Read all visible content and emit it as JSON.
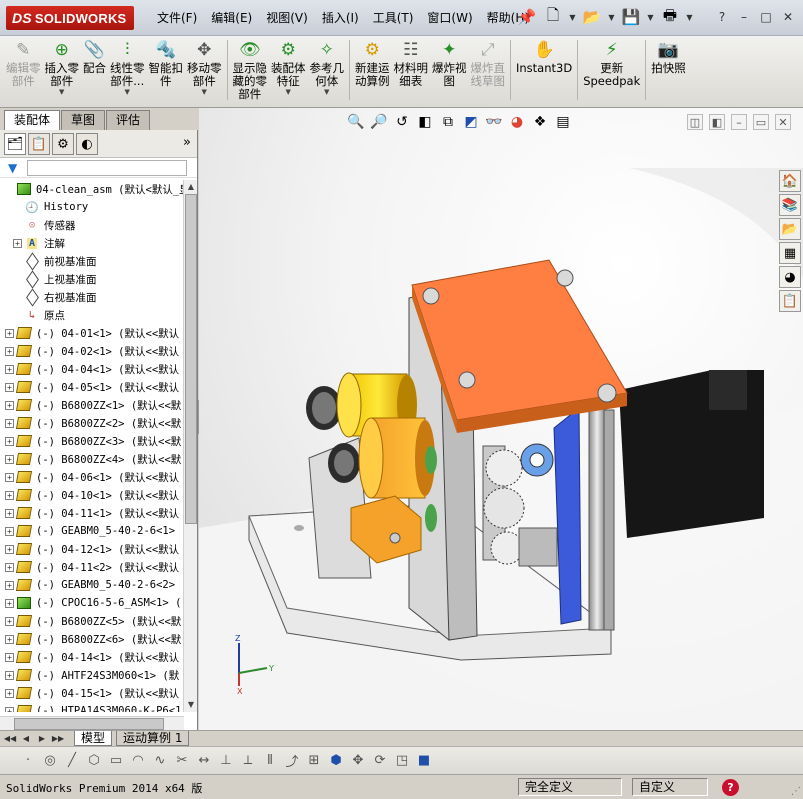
{
  "app": {
    "logo_ds": "DS",
    "logo_text": "SOLIDWORKS",
    "menus": [
      "文件(F)",
      "编辑(E)",
      "视图(V)",
      "插入(I)",
      "工具(T)",
      "窗口(W)",
      "帮助(H)"
    ],
    "topicons": [
      "pin-icon",
      "new-document-icon",
      "open-folder-icon",
      "save-icon",
      "print-icon",
      "help-icon"
    ],
    "window_controls": [
      "?",
      "–",
      "□",
      "✕"
    ]
  },
  "commands": [
    {
      "name": "edit-component",
      "label": "编辑零\n部件",
      "disabled": true,
      "dropdown": false
    },
    {
      "name": "insert-component",
      "label": "插入零\n部件",
      "disabled": false,
      "dropdown": true
    },
    {
      "name": "mate",
      "label": "配合",
      "disabled": false,
      "dropdown": false
    },
    {
      "name": "linear-pattern",
      "label": "线性零\n部件...",
      "disabled": false,
      "dropdown": true
    },
    {
      "name": "smart-fasteners",
      "label": "智能扣\n件",
      "disabled": false,
      "dropdown": false
    },
    {
      "name": "move-component",
      "label": "移动零\n部件",
      "disabled": false,
      "dropdown": true
    },
    {
      "name": "show-hidden",
      "label": "显示隐\n藏的零\n部件",
      "disabled": false,
      "dropdown": false
    },
    {
      "name": "assembly-feature",
      "label": "装配体\n特征",
      "disabled": false,
      "dropdown": true
    },
    {
      "name": "reference-geometry",
      "label": "参考几\n何体",
      "disabled": false,
      "dropdown": true
    },
    {
      "name": "new-motion-study",
      "label": "新建运\n动算例",
      "disabled": false,
      "dropdown": false
    },
    {
      "name": "bill-of-materials",
      "label": "材料明\n细表",
      "disabled": false,
      "dropdown": false
    },
    {
      "name": "exploded-view",
      "label": "爆炸视\n图",
      "disabled": false,
      "dropdown": false
    },
    {
      "name": "explode-line-sketch",
      "label": "爆炸直\n线草图",
      "disabled": true,
      "dropdown": false
    },
    {
      "name": "instant3d",
      "label": "Instant3D",
      "disabled": false,
      "dropdown": false
    },
    {
      "name": "update-speedpak",
      "label": "更新\nSpeedpak",
      "disabled": false,
      "dropdown": false
    },
    {
      "name": "take-snapshot",
      "label": "拍快照",
      "disabled": false,
      "dropdown": false
    }
  ],
  "left_tabs": [
    "装配体",
    "草图",
    "评估"
  ],
  "tree": [
    {
      "label": "04-clean_asm  (默认<默认_显",
      "icon": "asm",
      "exp": false,
      "indent": 0
    },
    {
      "label": "History",
      "icon": "history",
      "exp": false,
      "indent": 1
    },
    {
      "label": "传感器",
      "icon": "sensor",
      "exp": false,
      "indent": 1
    },
    {
      "label": "注解",
      "icon": "annotation",
      "exp": true,
      "indent": 1
    },
    {
      "label": "前视基准面",
      "icon": "plane",
      "exp": false,
      "indent": 1
    },
    {
      "label": "上视基准面",
      "icon": "plane",
      "exp": false,
      "indent": 1
    },
    {
      "label": "右视基准面",
      "icon": "plane",
      "exp": false,
      "indent": 1
    },
    {
      "label": "原点",
      "icon": "origin",
      "exp": false,
      "indent": 1
    },
    {
      "label": "(-) 04-01<1> (默认<<默认",
      "icon": "part",
      "exp": true,
      "indent": 0
    },
    {
      "label": "(-) 04-02<1> (默认<<默认",
      "icon": "part",
      "exp": true,
      "indent": 0
    },
    {
      "label": "(-) 04-04<1> (默认<<默认",
      "icon": "part",
      "exp": true,
      "indent": 0
    },
    {
      "label": "(-) 04-05<1> (默认<<默认",
      "icon": "part",
      "exp": true,
      "indent": 0
    },
    {
      "label": "(-) B6800ZZ<1> (默认<<默",
      "icon": "part",
      "exp": true,
      "indent": 0
    },
    {
      "label": "(-) B6800ZZ<2> (默认<<默",
      "icon": "part",
      "exp": true,
      "indent": 0
    },
    {
      "label": "(-) B6800ZZ<3> (默认<<默",
      "icon": "part",
      "exp": true,
      "indent": 0
    },
    {
      "label": "(-) B6800ZZ<4> (默认<<默",
      "icon": "part",
      "exp": true,
      "indent": 0
    },
    {
      "label": "(-) 04-06<1> (默认<<默认",
      "icon": "part",
      "exp": true,
      "indent": 0
    },
    {
      "label": "(-) 04-10<1> (默认<<默认",
      "icon": "part",
      "exp": true,
      "indent": 0
    },
    {
      "label": "(-) 04-11<1> (默认<<默认",
      "icon": "part",
      "exp": true,
      "indent": 0
    },
    {
      "label": "(-) GEABM0_5-40-2-6<1>",
      "icon": "part",
      "exp": true,
      "indent": 0
    },
    {
      "label": "(-) 04-12<1> (默认<<默认",
      "icon": "part",
      "exp": true,
      "indent": 0
    },
    {
      "label": "(-) 04-11<2> (默认<<默认",
      "icon": "part",
      "exp": true,
      "indent": 0
    },
    {
      "label": "(-) GEABM0_5-40-2-6<2>",
      "icon": "part",
      "exp": true,
      "indent": 0
    },
    {
      "label": "(-) CPOC16-5-6_ASM<1> (",
      "icon": "asm",
      "exp": true,
      "indent": 0
    },
    {
      "label": "(-) B6800ZZ<5> (默认<<默",
      "icon": "part",
      "exp": true,
      "indent": 0
    },
    {
      "label": "(-) B6800ZZ<6> (默认<<默",
      "icon": "part",
      "exp": true,
      "indent": 0
    },
    {
      "label": "(-) 04-14<1> (默认<<默认",
      "icon": "part",
      "exp": true,
      "indent": 0
    },
    {
      "label": "(-) AHTF24S3M060<1> (默",
      "icon": "part",
      "exp": true,
      "indent": 0
    },
    {
      "label": "(-) 04-15<1> (默认<<默认",
      "icon": "part",
      "exp": true,
      "indent": 0
    },
    {
      "label": "(-) HTPA14S3M060-K-P6<1",
      "icon": "part",
      "exp": true,
      "indent": 0
    }
  ],
  "bottom_tabs": [
    "模型",
    "运动算例 1"
  ],
  "status": {
    "text": "SolidWorks Premium 2014 x64 版",
    "cell1": "完全定义",
    "cell2": "自定义",
    "help": "?"
  }
}
